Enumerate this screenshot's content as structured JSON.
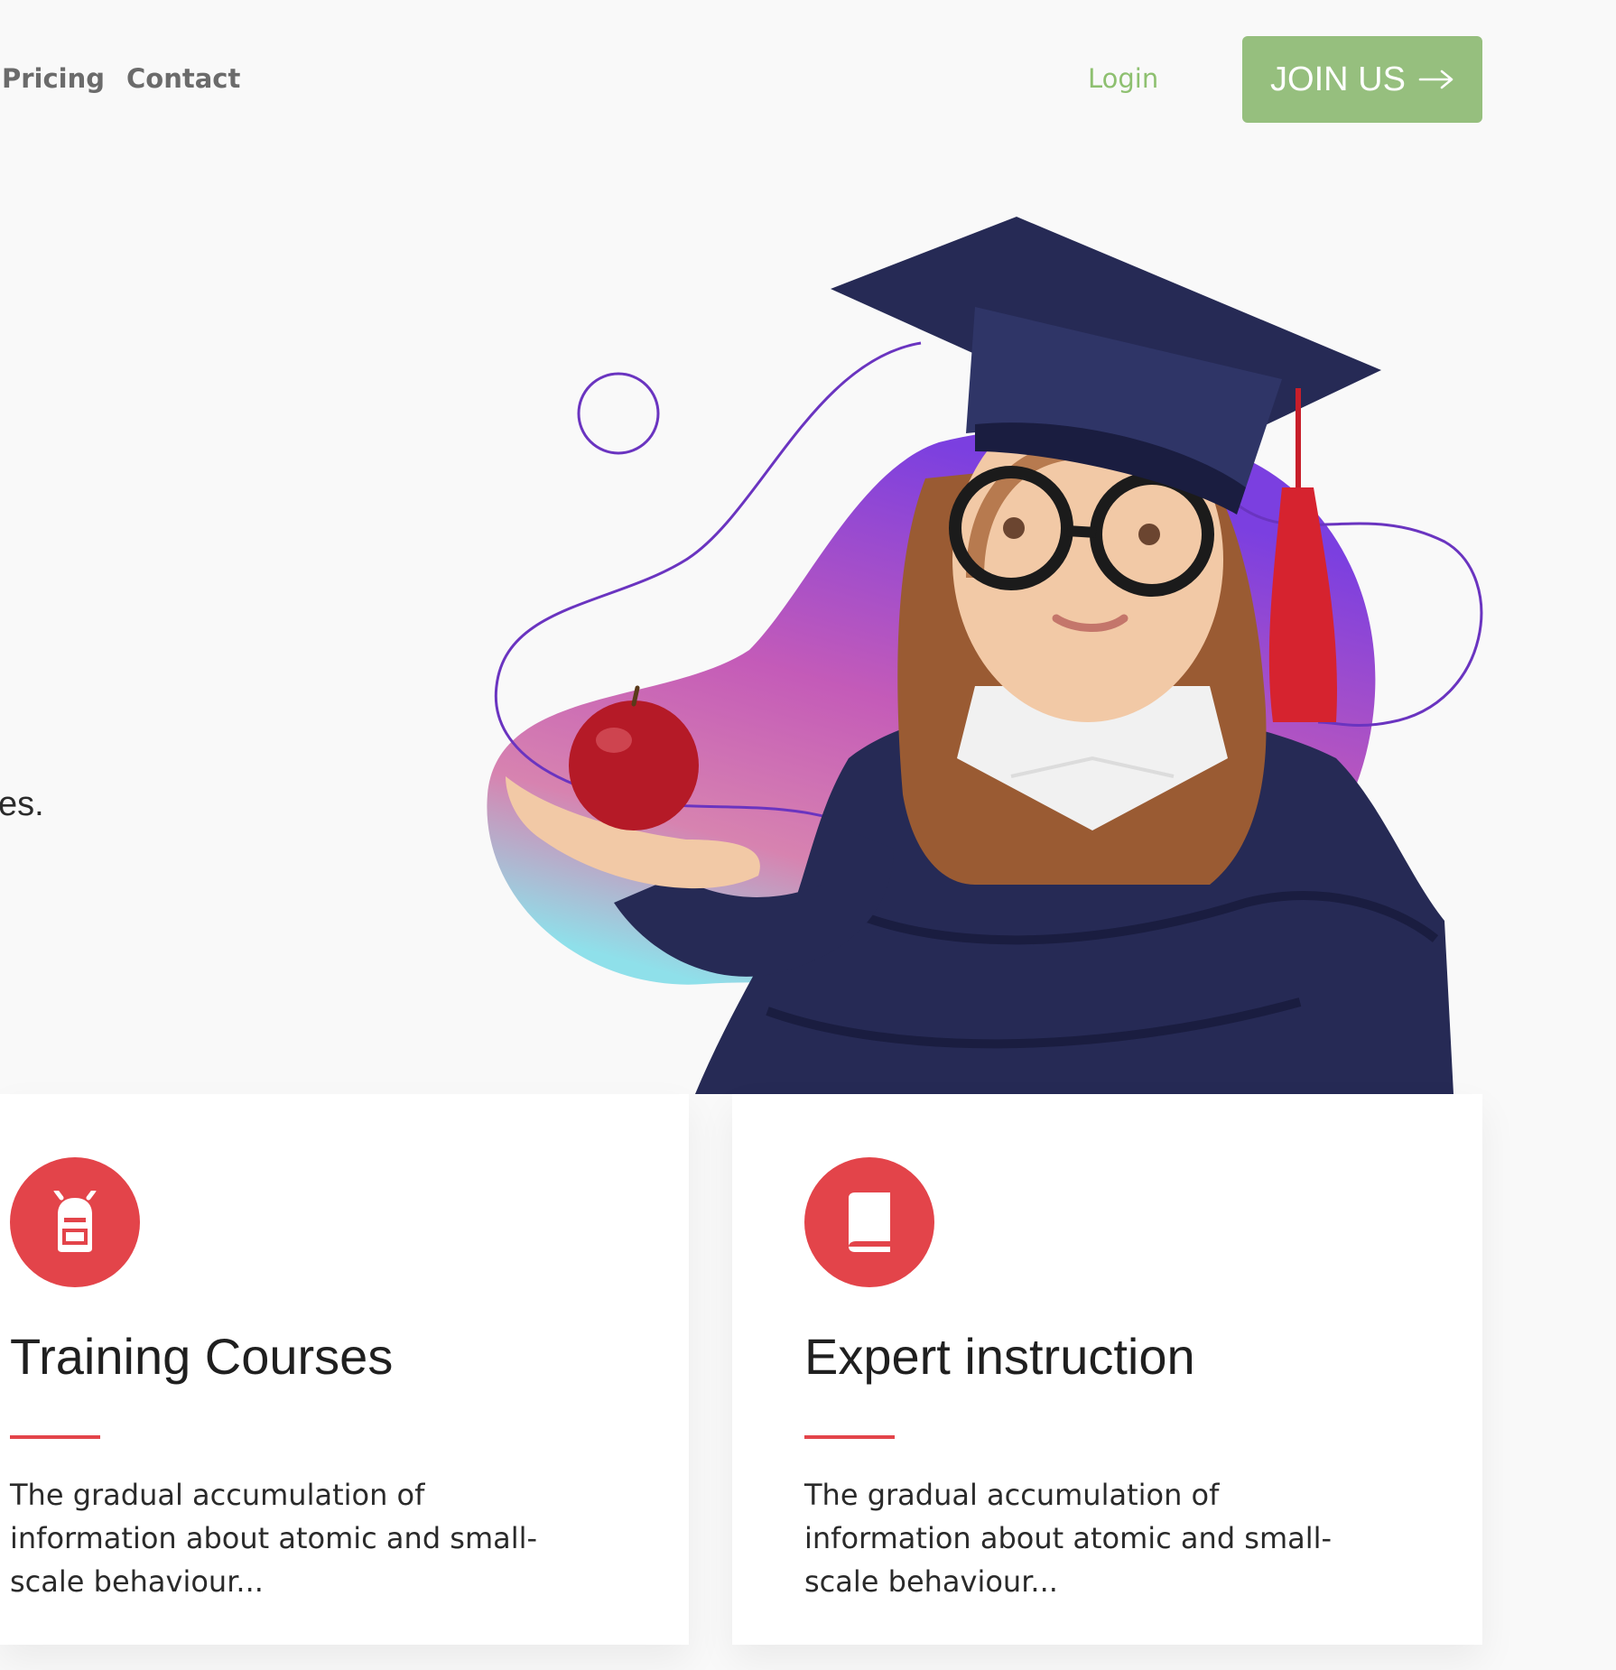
{
  "nav": {
    "items": [
      {
        "label": "Pricing"
      },
      {
        "label": "Contact"
      }
    ],
    "login_label": "Login",
    "join_label": "JOIN US"
  },
  "hero": {
    "text_fragment": "es.",
    "illustration": "graduate-girl-with-apple",
    "colors": {
      "blob_start": "#7b3fe0",
      "blob_mid": "#c45bb8",
      "blob_end": "#8fe0ea",
      "line": "#6a34c0"
    }
  },
  "features": [
    {
      "icon": "backpack-icon",
      "title": "Training Courses",
      "description": "The gradual accumulation of information about atomic and small-scale behaviour..."
    },
    {
      "icon": "book-icon",
      "title": "Expert instruction",
      "description": "The gradual accumulation of information about atomic and small-scale behaviour..."
    }
  ],
  "colors": {
    "accent_green": "#96bf7e",
    "accent_red": "#e3444a",
    "background": "#f9f9f9"
  }
}
